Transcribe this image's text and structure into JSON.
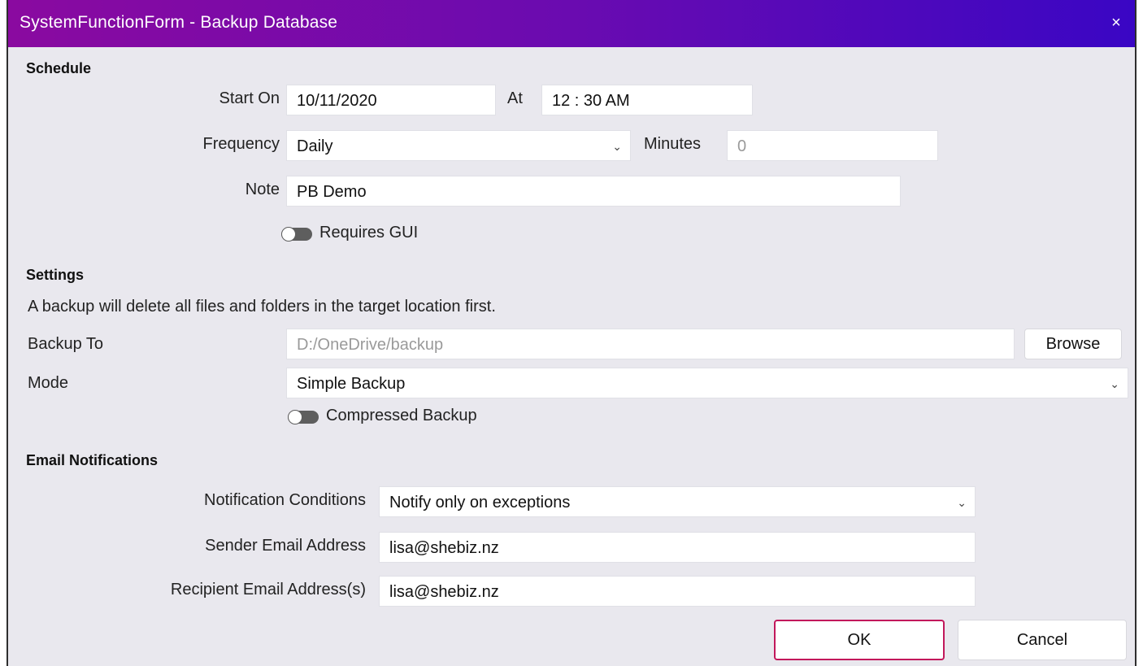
{
  "window": {
    "title": "SystemFunctionForm - Backup Database",
    "close_glyph": "×"
  },
  "schedule": {
    "section_title": "Schedule",
    "start_on_label": "Start On",
    "start_on_value": "10/11/2020",
    "at_label": "At",
    "at_value": "12 : 30 AM",
    "frequency_label": "Frequency",
    "frequency_value": "Daily",
    "minutes_label": "Minutes",
    "minutes_value": "0",
    "note_label": "Note",
    "note_value": "PB Demo",
    "requires_gui_label": "Requires GUI",
    "requires_gui_on": false
  },
  "settings": {
    "section_title": "Settings",
    "warning_text": "A backup will delete all files and folders in the target location first.",
    "backup_to_label": "Backup To",
    "backup_to_value": "D:/OneDrive/backup",
    "browse_label": "Browse",
    "mode_label": "Mode",
    "mode_value": "Simple Backup",
    "compressed_label": "Compressed Backup",
    "compressed_on": false
  },
  "email": {
    "section_title": "Email Notifications",
    "conditions_label": "Notification Conditions",
    "conditions_value": "Notify only on exceptions",
    "sender_label": "Sender Email Address",
    "sender_value": "lisa@shebiz.nz",
    "recipient_label": "Recipient Email Address(s)",
    "recipient_value": "lisa@shebiz.nz"
  },
  "buttons": {
    "ok_label": "OK",
    "cancel_label": "Cancel"
  },
  "icons": {
    "chevron": "⌄"
  }
}
